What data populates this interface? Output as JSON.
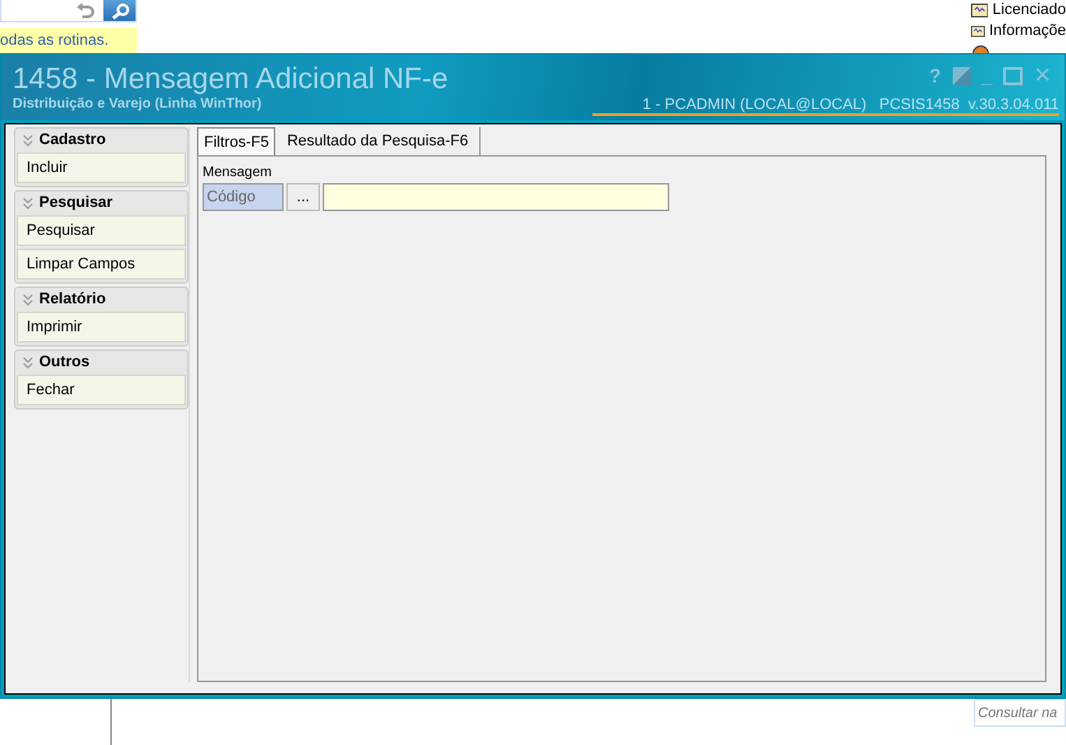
{
  "background": {
    "search_hint": "odas as rotinas.",
    "side_items": [
      {
        "label": "Licenciado"
      },
      {
        "label": "Informaçõe"
      }
    ],
    "query_field": {
      "placeholder": "Consultar na"
    }
  },
  "window": {
    "title": "1458 - Mensagem Adicional NF-e",
    "subtitle": "Distribuição e Varejo (Linha WinThor)",
    "controls": [
      "?",
      "_",
      "×"
    ],
    "session_info": "1 - PCADMIN (LOCAL@LOCAL)   PCSIS1458  v.30.3.04.011"
  },
  "sidebar": {
    "groups": [
      {
        "title": "Cadastro",
        "items": [
          "Incluir"
        ]
      },
      {
        "title": "Pesquisar",
        "items": [
          "Pesquisar",
          "Limpar Campos"
        ]
      },
      {
        "title": "Relatório",
        "items": [
          "Imprimir"
        ]
      },
      {
        "title": "Outros",
        "items": [
          "Fechar"
        ]
      }
    ]
  },
  "tabs": [
    {
      "label": "Filtros-F5",
      "selected": true
    },
    {
      "label": "Resultado da Pesquisa-F6",
      "selected": false
    }
  ],
  "filters": {
    "section": "Mensagem",
    "field_label": "Código",
    "lookup_button": "..."
  }
}
